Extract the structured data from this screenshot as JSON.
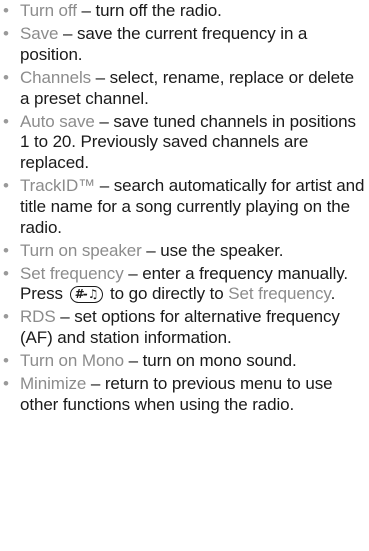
{
  "items": [
    {
      "term": "Turn off",
      "desc": "turn off the radio."
    },
    {
      "term": "Save",
      "desc": "save the current frequency in a position."
    },
    {
      "term": "Channels",
      "desc": "select, rename, replace or delete a preset channel."
    },
    {
      "term": "Auto save",
      "desc": "save tuned channels in positions 1 to 20. Previously saved channels are replaced."
    },
    {
      "term": "TrackID™",
      "desc": "search automatically for artist and title name for a song currently playing on the radio."
    },
    {
      "term": "Turn on speaker",
      "desc": "use the speaker."
    },
    {
      "term": "Set frequency",
      "desc": "enter a frequency manually. Press",
      "key_label": "#-♫",
      "desc_after": "to go directly to",
      "link_term": "Set frequency",
      "end": "."
    },
    {
      "term": "RDS",
      "desc": "set options for alternative frequency (AF) and station information."
    },
    {
      "term": "Turn on Mono",
      "desc": "turn on mono sound."
    },
    {
      "term": "Minimize",
      "desc": "return to previous menu to use other functions when using the radio."
    }
  ],
  "separator": "–",
  "bullet": "•"
}
